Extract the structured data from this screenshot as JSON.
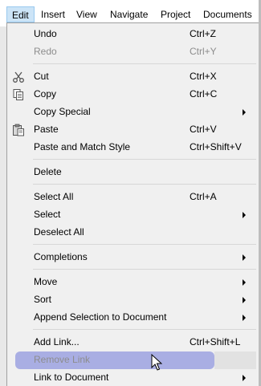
{
  "menubar": {
    "items": [
      {
        "label": "Edit"
      },
      {
        "label": "Insert"
      },
      {
        "label": "View"
      },
      {
        "label": "Navigate"
      },
      {
        "label": "Project"
      },
      {
        "label": "Documents"
      }
    ]
  },
  "menu": {
    "items": [
      {
        "label": "Undo",
        "shortcut": "Ctrl+Z"
      },
      {
        "label": "Redo",
        "shortcut": "Ctrl+Y",
        "disabled": true
      },
      {
        "label": "Cut",
        "shortcut": "Ctrl+X",
        "icon": "scissors-icon"
      },
      {
        "label": "Copy",
        "shortcut": "Ctrl+C",
        "icon": "copy-icon"
      },
      {
        "label": "Copy Special",
        "submenu": true
      },
      {
        "label": "Paste",
        "shortcut": "Ctrl+V",
        "icon": "clipboard-icon"
      },
      {
        "label": "Paste and Match Style",
        "shortcut": "Ctrl+Shift+V"
      },
      {
        "label": "Delete"
      },
      {
        "label": "Select All",
        "shortcut": "Ctrl+A"
      },
      {
        "label": "Select",
        "submenu": true
      },
      {
        "label": "Deselect All"
      },
      {
        "label": "Completions",
        "submenu": true
      },
      {
        "label": "Move",
        "submenu": true
      },
      {
        "label": "Sort",
        "submenu": true
      },
      {
        "label": "Append Selection to Document",
        "submenu": true
      },
      {
        "label": "Add Link...",
        "shortcut": "Ctrl+Shift+L"
      },
      {
        "label": "Remove Link",
        "disabled": true,
        "hovered": true
      },
      {
        "label": "Link to Document",
        "submenu": true
      }
    ]
  },
  "colors": {
    "hover": "#a9aee3",
    "active_menu": "#cce4f7",
    "disabled_text": "#8d8d8d"
  }
}
